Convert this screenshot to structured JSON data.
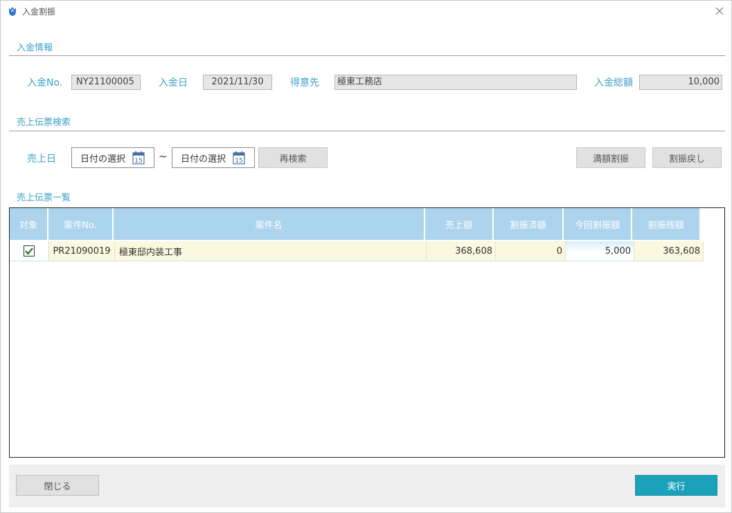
{
  "window": {
    "title": "入金割振"
  },
  "payment_info": {
    "section_title": "入金情報",
    "payment_no_label": "入金No.",
    "payment_no": "NY21100005",
    "payment_date_label": "入金日",
    "payment_date": "2021/11/30",
    "customer_label": "得意先",
    "customer": "極東工務店",
    "total_label": "入金総額",
    "total": "10,000"
  },
  "search": {
    "section_title": "売上伝票検索",
    "sales_date_label": "売上日",
    "date_from_placeholder": "日付の選択",
    "date_to_placeholder": "日付の選択",
    "range_separator": "~",
    "research_button": "再検索",
    "full_allocate_button": "満額割振",
    "allocation_revert_button": "割振戻し"
  },
  "list": {
    "section_title": "売上伝票一覧",
    "columns": [
      "対象",
      "案件No.",
      "案件名",
      "売上額",
      "割振済額",
      "今回割振額",
      "割振残額"
    ],
    "rows": [
      {
        "checked": true,
        "case_no": "PR21090019",
        "case_name": "極東邸内装工事",
        "sales_amount": "368,608",
        "allocated": "0",
        "current_allocation": "5,000",
        "remaining": "363,608"
      }
    ]
  },
  "footer": {
    "close_button": "閉じる",
    "run_button": "実行"
  },
  "colors": {
    "accent": "#3aa0c8",
    "header_bg": "#acd4ec",
    "row_bg": "#fbf8e0",
    "run_button": "#1ba1b9"
  },
  "icons": {
    "app": "tulip-icon",
    "close": "close-icon",
    "calendar": "calendar-icon",
    "check": "check-icon"
  }
}
